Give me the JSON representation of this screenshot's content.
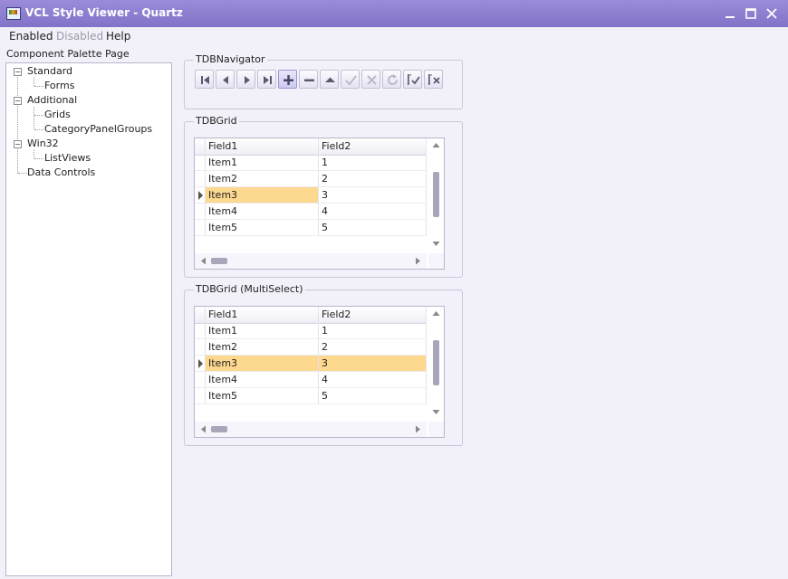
{
  "window": {
    "title": "VCL Style Viewer - Quartz",
    "controls": [
      "minimize-icon",
      "maximize-icon",
      "close-icon"
    ]
  },
  "menu": [
    {
      "label": "Enabled",
      "enabled": true
    },
    {
      "label": "Disabled",
      "enabled": false
    },
    {
      "label": "Help",
      "enabled": true
    }
  ],
  "palette": {
    "label": "Component Palette Page",
    "tree": [
      {
        "label": "Standard",
        "children": [
          "Forms"
        ]
      },
      {
        "label": "Additional",
        "children": [
          "Grids",
          "CategoryPanelGroups"
        ]
      },
      {
        "label": "Win32",
        "children": [
          "ListViews"
        ]
      },
      {
        "label": "Data Controls",
        "children": []
      }
    ]
  },
  "navigator": {
    "title": "TDBNavigator",
    "buttons": [
      {
        "icon": "first-record-icon",
        "enabled": true
      },
      {
        "icon": "prior-record-icon",
        "enabled": true
      },
      {
        "icon": "next-record-icon",
        "enabled": true
      },
      {
        "icon": "last-record-icon",
        "enabled": true
      },
      {
        "icon": "insert-icon",
        "enabled": true,
        "active": true
      },
      {
        "icon": "delete-icon",
        "enabled": true
      },
      {
        "icon": "edit-icon",
        "enabled": true
      },
      {
        "icon": "post-icon",
        "enabled": false
      },
      {
        "icon": "cancel-icon",
        "enabled": false
      },
      {
        "icon": "refresh-icon",
        "enabled": false
      },
      {
        "icon": "apply-updates-icon",
        "enabled": true
      },
      {
        "icon": "cancel-updates-icon",
        "enabled": true
      }
    ]
  },
  "grids": [
    {
      "title": "TDBGrid",
      "columns": [
        "Field1",
        "Field2"
      ],
      "rows": [
        [
          "Item1",
          "1"
        ],
        [
          "Item2",
          "2"
        ],
        [
          "Item3",
          "3"
        ],
        [
          "Item4",
          "4"
        ],
        [
          "Item5",
          "5"
        ]
      ],
      "selected_row": 2,
      "multiselect": false
    },
    {
      "title": "TDBGrid (MultiSelect)",
      "columns": [
        "Field1",
        "Field2"
      ],
      "rows": [
        [
          "Item1",
          "1"
        ],
        [
          "Item2",
          "2"
        ],
        [
          "Item3",
          "3"
        ],
        [
          "Item4",
          "4"
        ],
        [
          "Item5",
          "5"
        ]
      ],
      "selected_row": 2,
      "multiselect": true
    }
  ],
  "colors": {
    "titlebar": "#8f80d2",
    "selection": "#fdd88f",
    "accent": "#8a7fd0"
  }
}
